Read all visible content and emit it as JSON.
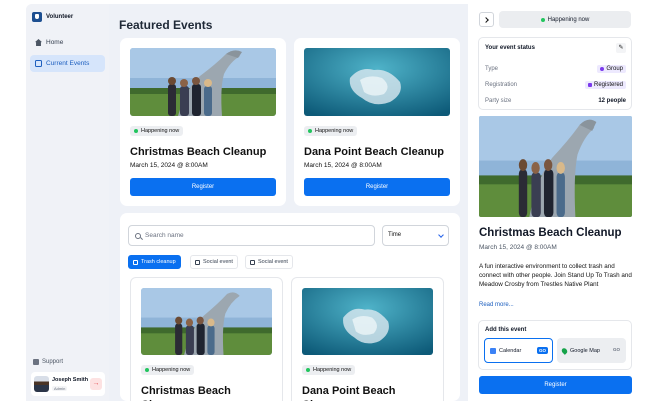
{
  "app": {
    "name": "Volunteer"
  },
  "sidebar": {
    "items": [
      {
        "label": "Home",
        "icon": "home-icon",
        "active": false
      },
      {
        "label": "Current Events",
        "icon": "calendar-icon",
        "active": true
      }
    ],
    "support_label": "Support",
    "user": {
      "name": "Joseph Smith",
      "role": "Admin"
    }
  },
  "main": {
    "title": "Featured Events",
    "featured": [
      {
        "status": "Happening now",
        "title": "Christmas Beach Cleanup",
        "date": "March 15, 2024 @ 8:00AM",
        "button": "Register",
        "image": "whale-tail-sculpture-photo"
      },
      {
        "status": "Happening now",
        "title": "Dana Point Beach Cleanup",
        "date": "March 15, 2024 @ 8:00AM",
        "button": "Register",
        "image": "plastic-bag-underwater-photo"
      }
    ],
    "search": {
      "placeholder": "Search name"
    },
    "time_select": {
      "value": "Time"
    },
    "filters": [
      {
        "label": "Trash cleanup",
        "active": true
      },
      {
        "label": "Social event",
        "active": false
      },
      {
        "label": "Social event",
        "active": false
      }
    ],
    "events": [
      {
        "status": "Happening now",
        "title": "Christmas Beach Cleanup"
      },
      {
        "status": "Happening now",
        "title": "Dana Point Beach Cleanup"
      }
    ]
  },
  "detail": {
    "status_pill": "Happening now",
    "status_box": {
      "heading": "Your event status",
      "rows": [
        {
          "label": "Type",
          "value": "Group"
        },
        {
          "label": "Registration",
          "value": "Registered"
        },
        {
          "label": "Party size",
          "value": "12 people"
        }
      ]
    },
    "title": "Christmas Beach Cleanup",
    "date": "March 15, 2024 @ 8:00AM",
    "description": "A fun interactive environment to collect trash and connect with other people. Join Stand Up To Trash and Meadow Crosby from Trestles Native Plant",
    "read_more": "Read more...",
    "add_event": {
      "heading": "Add this event",
      "options": [
        {
          "label": "Calendar",
          "action": "GO"
        },
        {
          "label": "Google Map",
          "action": "GO"
        }
      ]
    },
    "register_button": "Register"
  },
  "colors": {
    "accent": "#0a70f0",
    "status_dot": "#22c55e",
    "nav_active_bg": "#d6e5fb"
  }
}
